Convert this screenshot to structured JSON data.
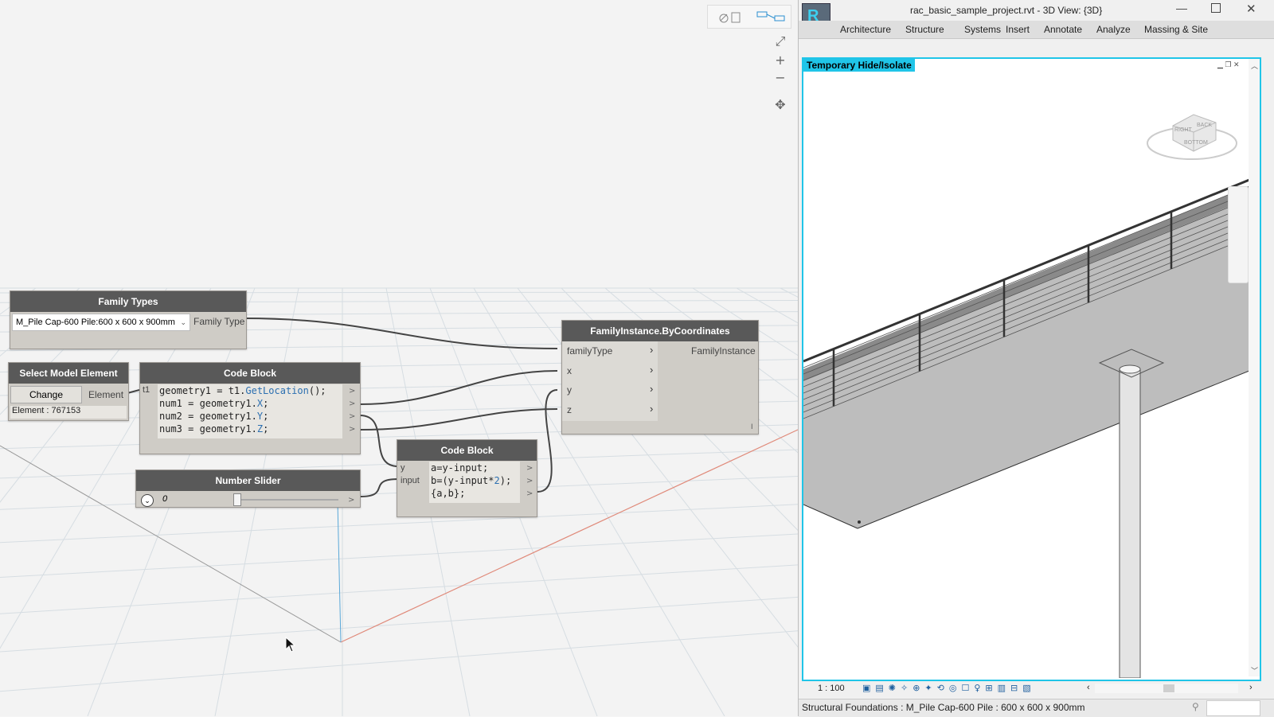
{
  "canvas": {
    "toolbar_icons": [
      "background-preview-icon",
      "graph-view-icon"
    ],
    "zoom_controls": [
      "fit-view-icon",
      "zoom-in-icon",
      "zoom-out-icon",
      "pan-icon"
    ]
  },
  "nodes": {
    "family_types": {
      "title": "Family Types",
      "selected": "M_Pile Cap-600 Pile:600 x 600 x 900mm",
      "output": "Family Type"
    },
    "select_element": {
      "title": "Select Model Element",
      "button": "Change",
      "output": "Element",
      "info": "Element : 767153"
    },
    "code_block_1": {
      "title": "Code Block",
      "input": "t1",
      "lines": [
        {
          "pre": "geometry1 = t1.",
          "hl": "GetLocation",
          "post": "();"
        },
        {
          "pre": "num1 = geometry1.",
          "hl": "X",
          "post": ";"
        },
        {
          "pre": "num2 = geometry1.",
          "hl": "Y",
          "post": ";"
        },
        {
          "pre": "num3 = geometry1.",
          "hl": "Z",
          "post": ";"
        }
      ]
    },
    "number_slider": {
      "title": "Number Slider",
      "value": "0"
    },
    "code_block_2": {
      "title": "Code Block",
      "inputs": [
        "y",
        "input"
      ],
      "lines": [
        {
          "pre": "a=y-input;",
          "hl": "",
          "post": ""
        },
        {
          "pre": "b=(y-input*",
          "hl": "2",
          "post": ");"
        },
        {
          "pre": "{a,b};",
          "hl": "",
          "post": ""
        }
      ]
    },
    "family_instance": {
      "title": "FamilyInstance.ByCoordinates",
      "inputs": [
        "familyType",
        "x",
        "y",
        "z"
      ],
      "output": "FamilyInstance",
      "lacing": "I"
    }
  },
  "revit": {
    "window_title": "rac_basic_sample_project.rvt - 3D View: {3D}",
    "app_button": "R",
    "tabs": [
      "Architecture",
      "Structure",
      "Systems",
      "Insert",
      "Annotate",
      "Analyze",
      "Massing & Site"
    ],
    "temp_hide_label": "Temporary Hide/Isolate",
    "scale": "1 : 100",
    "viewcube_faces": [
      "RIGHT",
      "BACK",
      "BOTTOM"
    ],
    "status_text": "Structural Foundations : M_Pile Cap-600 Pile : 600 x 600 x 900mm",
    "accent_color": "#20c5e8"
  }
}
